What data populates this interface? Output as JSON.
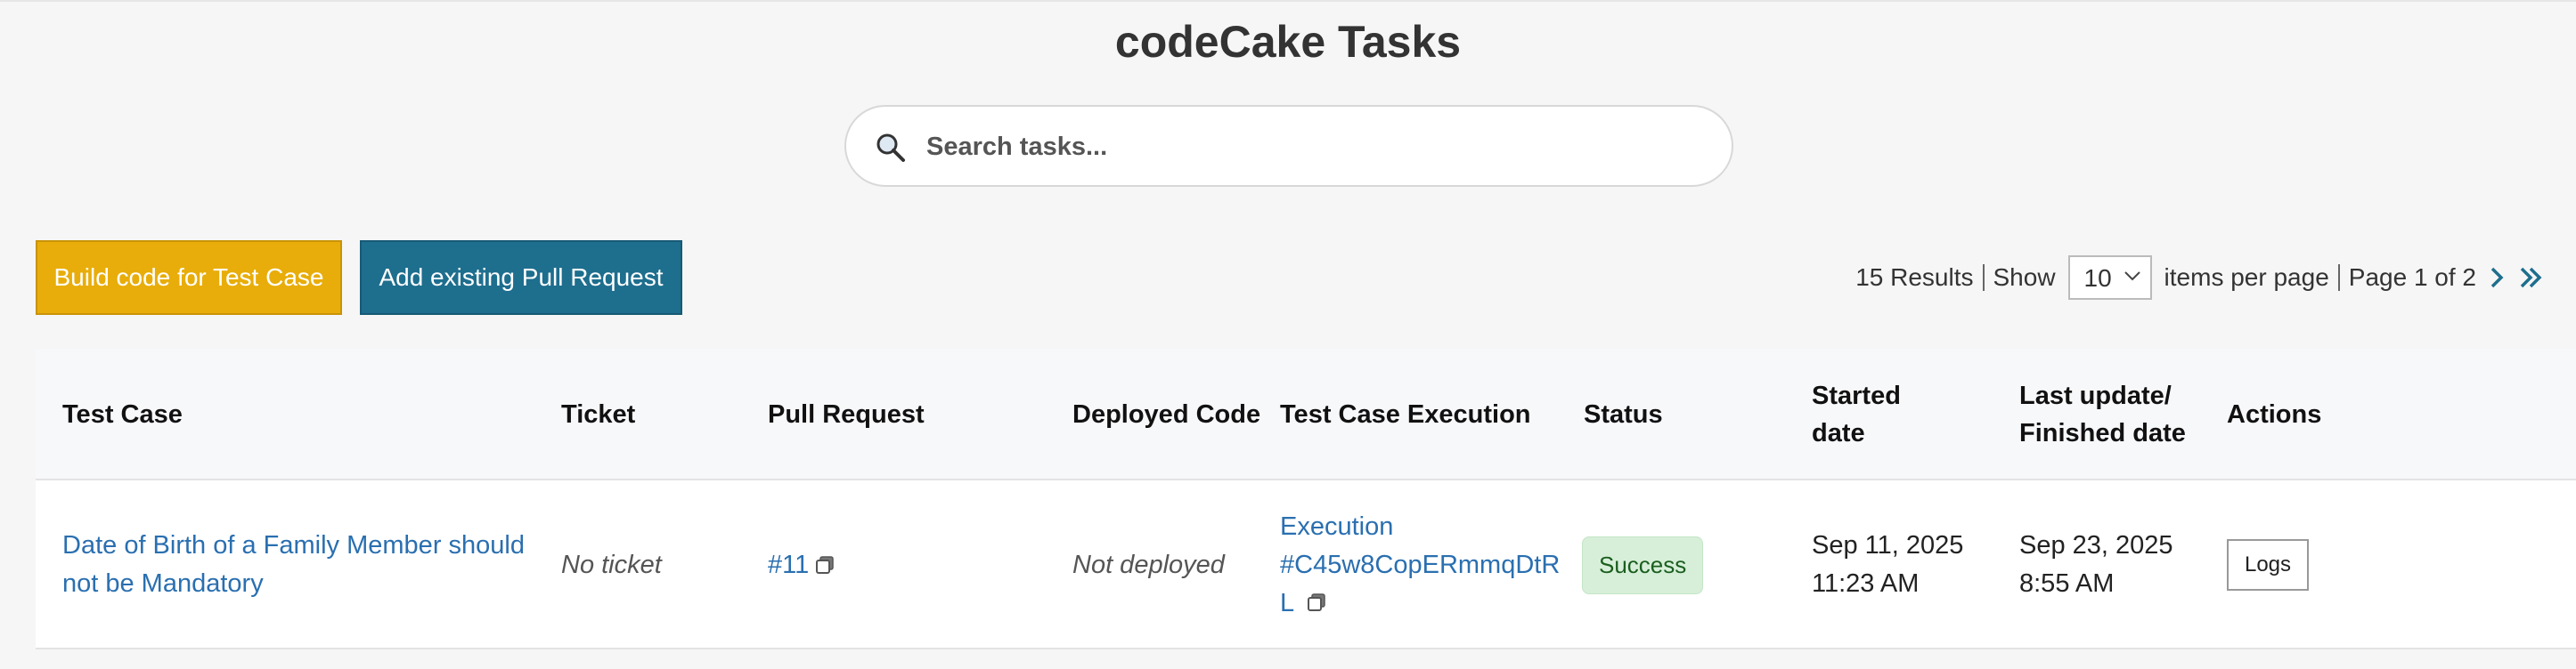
{
  "header": {
    "title": "codeCake Tasks"
  },
  "search": {
    "placeholder": "Search tasks..."
  },
  "toolbar": {
    "build_label": "Build code for Test Case",
    "add_pr_label": "Add existing Pull Request"
  },
  "pagination": {
    "results": "15 Results",
    "show_label": "Show",
    "per_page_value": "10",
    "per_page_label": "items per page",
    "page_info": "Page 1 of 2"
  },
  "table": {
    "headers": {
      "test_case": "Test Case",
      "ticket": "Ticket",
      "pull_request": "Pull Request",
      "deployed_code": "Deployed Code",
      "execution": "Test Case Execution",
      "status": "Status",
      "started_line1": "Started",
      "started_line2": "date",
      "updated_line1": "Last update/",
      "updated_line2": "Finished date",
      "actions": "Actions"
    },
    "rows": [
      {
        "test_case_line1": "Date of Birth of a Family Member should",
        "test_case_line2": "not be Mandatory",
        "ticket": "No ticket",
        "pull_request": "#11",
        "deployed_code": "Not deployed",
        "execution_line1": "Execution",
        "execution_line2": "#C45w8CopERmmqDtR",
        "execution_line3": "L",
        "status": "Success",
        "started_date": "Sep 11, 2025",
        "started_time": "11:23 AM",
        "updated_date": "Sep 23, 2025",
        "updated_time": "8:55 AM",
        "action_label": "Logs"
      }
    ]
  },
  "colors": {
    "build_button": "#e8ad0a",
    "add_pr_button": "#1e6e8e",
    "link": "#2a6fb0",
    "success_badge": "#d7efd9",
    "nav_icon": "#1e6e8e"
  },
  "icons": {
    "search": "search-icon",
    "copy": "copy-icon",
    "next": "chevron-right-icon",
    "last": "double-chevron-right-icon",
    "select_caret": "chevron-down-icon"
  }
}
